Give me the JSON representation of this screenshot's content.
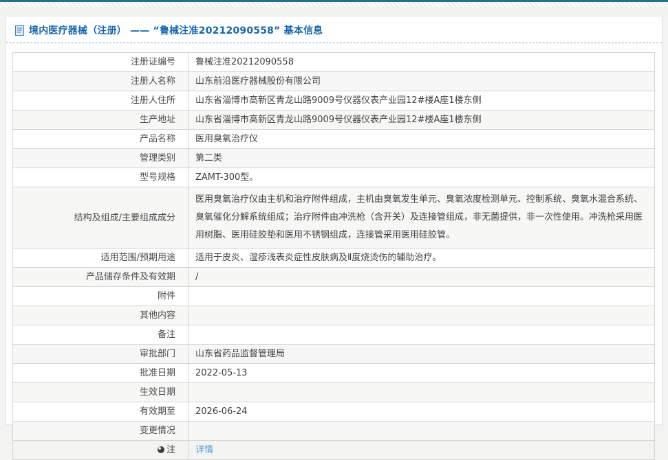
{
  "header": {
    "title": "境内医疗器械（注册） —— “鲁械注准20212090558” 基本信息"
  },
  "colors": {
    "top_bar_teal": "#26708e",
    "title_blue": "#1565ae",
    "link_blue": "#4f9bd9",
    "row_alt_gray": "#f7f7f6",
    "border_gray": "#d4d4d2"
  },
  "icons": {
    "header_icon": "document-icon",
    "note_row_icon": "note-icon"
  },
  "table": {
    "rows": [
      {
        "label": "注册证编号",
        "value": "鲁械注准20212090558"
      },
      {
        "label": "注册人名称",
        "value": "山东前沿医疗器械股份有限公司"
      },
      {
        "label": "注册人住所",
        "value": "山东省淄博市高新区青龙山路9009号仪器仪表产业园12#楼A座1楼东侧"
      },
      {
        "label": "生产地址",
        "value": "山东省淄博市高新区青龙山路9009号仪器仪表产业园12#楼A座1楼东侧"
      },
      {
        "label": "产品名称",
        "value": "医用臭氧治疗仪"
      },
      {
        "label": "管理类别",
        "value": "第二类"
      },
      {
        "label": "型号规格",
        "value": "ZAMT-300型。"
      },
      {
        "label": "结构及组成/主要组成成分",
        "value": "医用臭氧治疗仪由主机和治疗附件组成，主机由臭氧发生单元、臭氧浓度检测单元、控制系统、臭氧水混合系统、臭氧催化分解系统组成；治疗附件由冲洗枪（含开关）及连接管组成，非无菌提供，非一次性使用。冲洗枪采用医用树脂、医用硅胶垫和医用不锈钢组成，连接管采用医用硅胶管。",
        "multiline": true
      },
      {
        "label": "适用范围/预期用途",
        "value": "适用于皮炎、湿疹浅表炎症性皮肤病及Ⅱ度烧烫伤的辅助治疗。"
      },
      {
        "label": "产品储存条件及有效期",
        "value": "/"
      },
      {
        "label": "附件",
        "value": ""
      },
      {
        "label": "其他内容",
        "value": ""
      },
      {
        "label": "备注",
        "value": ""
      },
      {
        "label": "审批部门",
        "value": "山东省药品监督管理局"
      },
      {
        "label": "批准日期",
        "value": "2022-05-13"
      },
      {
        "label": "生效日期",
        "value": ""
      },
      {
        "label": "有效期至",
        "value": "2026-06-24"
      },
      {
        "label": "变更情况",
        "value": ""
      },
      {
        "label": "注",
        "value": "详情",
        "icon": "note-icon",
        "link": true
      }
    ]
  }
}
